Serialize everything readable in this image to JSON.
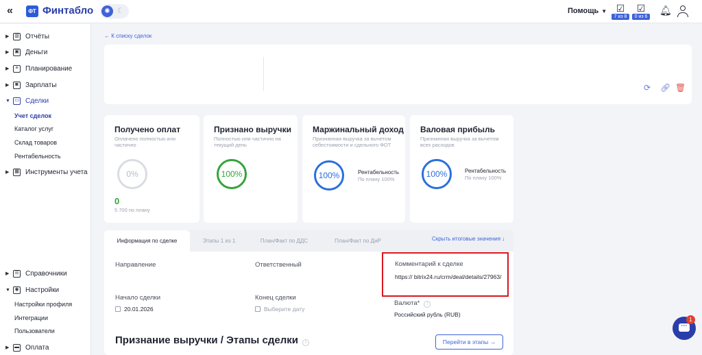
{
  "app": {
    "logo_badge": "ФТ",
    "brand": "Финтабло",
    "collapse_glyph": "«"
  },
  "header": {
    "help_label": "Помощь",
    "tasks": [
      {
        "icon": "checklist-icon",
        "badge": "7 из 8"
      },
      {
        "icon": "checklist-icon",
        "badge": "0 из 6"
      }
    ]
  },
  "sidebar": {
    "items": [
      {
        "label": "Отчёты",
        "icon": "report-icon"
      },
      {
        "label": "Деньги",
        "icon": "wallet-icon"
      },
      {
        "label": "Планирование",
        "icon": "planning-icon"
      },
      {
        "label": "Зарплаты",
        "icon": "salary-icon"
      },
      {
        "label": "Сделки",
        "icon": "deals-icon",
        "active": true
      },
      {
        "label": "Инструменты учета",
        "icon": "tools-icon"
      }
    ],
    "deals_sub": [
      "Учет сделок",
      "Каталог услуг",
      "Склад товаров",
      "Рентабельность"
    ],
    "bottom_items": [
      {
        "label": "Справочники",
        "icon": "directory-icon"
      },
      {
        "label": "Настройки",
        "icon": "settings-icon"
      }
    ],
    "settings_sub": [
      "Настройки профиля",
      "Интеграции",
      "Пользователи"
    ],
    "payment": {
      "label": "Оплата",
      "icon": "card-icon"
    }
  },
  "main": {
    "back_link": "← К списку сделок",
    "metrics": [
      {
        "title": "Получено оплат",
        "subtitle": "Оплачено полностью или частично",
        "percent": "0%",
        "amount": "0",
        "plan_note": "5 700 по плану"
      },
      {
        "title": "Признано выручки",
        "subtitle": "Полностью или частично на текущий день",
        "percent": "100%"
      },
      {
        "title": "Маржинальный доход",
        "subtitle": "Признанная выручка за вычетом себестоимости и сдельного ФОТ",
        "percent": "100%",
        "rent_label": "Рентабельность",
        "rent_plan": "По плану 100%"
      },
      {
        "title": "Валовая прибыль",
        "subtitle": "Признанная выручка за вычетом всех расходов",
        "percent": "100%",
        "rent_label": "Рентабельность",
        "rent_plan": "По плану 100%"
      }
    ],
    "tabs": [
      "Информация по сделке",
      "Этапы 1 из 1",
      "План/Факт по ДДС",
      "План/Факт по ДиР"
    ],
    "hide_totals": "Скрыть итоговые значения",
    "fields": {
      "direction_label": "Направление",
      "responsible_label": "Ответственный",
      "comment_label": "Комментарий к сделке",
      "comment_value": "https://          bitrix24.ru/crm/deal/details/27963/",
      "start_label": "Начало сделки",
      "start_value": "20.01.2026",
      "end_label": "Конец сделки",
      "end_placeholder": "Выберите дату",
      "currency_label": "Валюта*",
      "currency_value": "Российский рубль (RUB)"
    },
    "section_title": "Признание выручки / Этапы сделки",
    "stages_button": "Перейти в этапы →"
  },
  "chat": {
    "badge": "1"
  }
}
